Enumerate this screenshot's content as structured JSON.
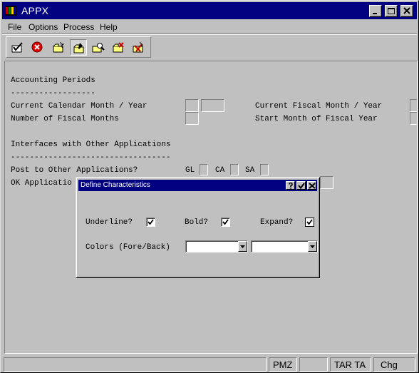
{
  "window": {
    "title": "APPX"
  },
  "menu": {
    "items": [
      {
        "label": "File"
      },
      {
        "label": "Options"
      },
      {
        "label": "Process"
      },
      {
        "label": "Help"
      }
    ]
  },
  "toolbar": {
    "icons": [
      "ok-check-icon",
      "cancel-icon",
      "new-record-icon",
      "change-record-icon",
      "inquire-icon",
      "delete-record-icon",
      "undo-icon"
    ]
  },
  "form": {
    "section1_title": "Accounting Periods",
    "section1_rule": "------------------",
    "current_cal_label": "Current Calendar Month / Year",
    "num_fiscal_label": "Number of Fiscal Months",
    "current_fiscal_label": "Current Fiscal Month / Year",
    "start_month_label": "Start Month of Fiscal Year",
    "section2_title": "Interfaces with Other Applications",
    "section2_rule": "----------------------------------",
    "post_label": "Post to Other Applications?",
    "gl_label": "GL",
    "ca_label": "CA",
    "sa_label": "SA",
    "ok_label": "OK Applicatio"
  },
  "dialog": {
    "title": "Define Characteristics",
    "underline_label": "Underline?",
    "underline_checked": true,
    "bold_label": "Bold?",
    "bold_checked": true,
    "expand_label": "Expand?",
    "expand_checked": true,
    "colors_label": "Colors (Fore/Back)",
    "fore_value": "",
    "back_value": ""
  },
  "status": {
    "fields": [
      "",
      "PMZ",
      "",
      "TAR TA",
      "Chg"
    ]
  }
}
